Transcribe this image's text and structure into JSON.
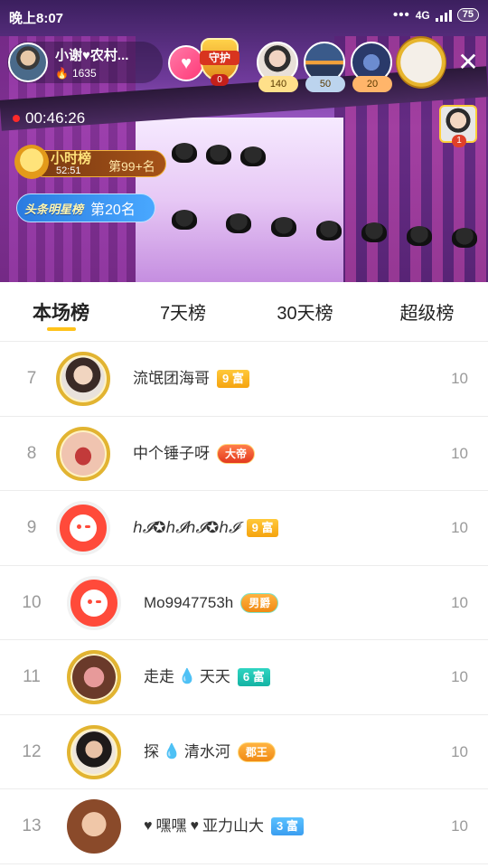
{
  "status_bar": {
    "time": "晚上8:07",
    "dots": "•••",
    "network": "4G",
    "battery": "75"
  },
  "host": {
    "name": "小谢♥农村...",
    "fans": "1635"
  },
  "guard": {
    "label": "守护",
    "count": "0"
  },
  "viewers": [
    {
      "badge": "140",
      "badge_color": "#ffe08a"
    },
    {
      "badge": "50",
      "badge_color": "#bcd4ee"
    },
    {
      "badge": "20",
      "badge_color": "#ffb56a"
    }
  ],
  "live": {
    "timer": "00:46:26"
  },
  "hour_rank": {
    "title": "小时榜",
    "time": "52:51",
    "place": "第99+名"
  },
  "star_rank": {
    "title": "头条明星榜",
    "place": "第20名"
  },
  "mini_viewer": {
    "num": "1"
  },
  "tabs": [
    {
      "label": "本场榜",
      "active": true
    },
    {
      "label": "7天榜",
      "active": false
    },
    {
      "label": "30天榜",
      "active": false
    },
    {
      "label": "超级榜",
      "active": false
    }
  ],
  "rows": [
    {
      "rank": "7",
      "name": "流氓团海哥",
      "level": "9 富",
      "level_style": "gold",
      "score": "10"
    },
    {
      "rank": "8",
      "name": "中个锤子呀",
      "noble": "大帝",
      "noble_style": "red",
      "score": "10"
    },
    {
      "rank": "9",
      "name": "ℎ𝓘✪ℎ𝓘ℎ𝓘✪ℎ𝓘",
      "level": "9 富",
      "level_style": "gold",
      "score": "10"
    },
    {
      "rank": "10",
      "name": "Mo9947753h",
      "noble": "男爵",
      "noble_style": "teal",
      "score": "10"
    },
    {
      "rank": "11",
      "name_a": "走走",
      "name_b": "天天",
      "level": "6 富",
      "level_style": "teal",
      "score": "10"
    },
    {
      "rank": "12",
      "name_a": "探",
      "name_b": "清水河",
      "noble": "郡王",
      "noble_style": "orange",
      "score": "10"
    },
    {
      "rank": "13",
      "name_a": "嘿嘿",
      "name_b": "亚力山大",
      "level": "3 富",
      "level_style": "blue",
      "score": "10"
    }
  ]
}
